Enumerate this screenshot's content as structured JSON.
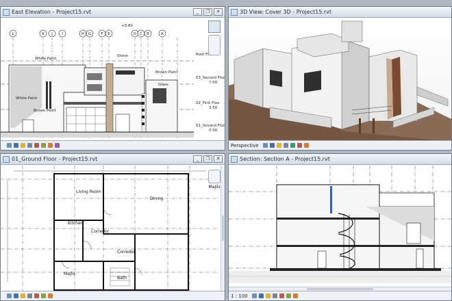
{
  "windows": {
    "elevation": {
      "title": "East Elevation - Project15.rvt",
      "scale": ""
    },
    "view3d": {
      "title": "3D View: Cover 3D - Project15.rvt",
      "scale": "Perspective"
    },
    "plan": {
      "title": "01_Ground Floor - Project15.rvt",
      "scale": ""
    },
    "section": {
      "title": "Section: Section A - Project15.rvt",
      "scale": "1 : 100"
    }
  },
  "window_buttons": {
    "minimize": "_",
    "restore": "❐",
    "close": "✕"
  },
  "elevation": {
    "grid_bubbles": [
      "L",
      "K",
      "J",
      "I",
      "H",
      "G",
      "F",
      "E",
      "D",
      "C",
      "B",
      "A"
    ],
    "level_labels": [
      {
        "name": "Roof Floor",
        "value": ""
      },
      {
        "name": "03_Second Floo",
        "value": "7.00"
      },
      {
        "name": "02_First Floo",
        "value": "3.50"
      },
      {
        "name": "01_Ground Floo",
        "value": "0.00"
      }
    ],
    "material_tags": [
      "White Paint",
      "Stone",
      "Brown Paint",
      "Glass",
      "White Paint",
      "Brown Paint"
    ],
    "top_dim": "+9.80"
  },
  "plan": {
    "rooms": [
      "Living Room",
      "Dining",
      "Kitchen",
      "Corredor",
      "Corredor",
      "Majlis",
      "Bath"
    ],
    "nav_label": "Majlis"
  },
  "colors": {
    "frame": "#6f7a88",
    "titlebar": "#dbe2eb",
    "wood_brown": "#7a4b2e",
    "stone": "#c6ab93",
    "section_blue": "#2f5cc8"
  }
}
